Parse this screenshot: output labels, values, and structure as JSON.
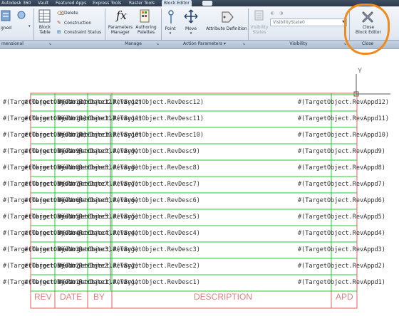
{
  "tabs": [
    "Autodesk 360",
    "Vault",
    "Featured Apps",
    "Express Tools",
    "Raster Tools",
    "Block Editor"
  ],
  "ribbon": {
    "left_partial": "gned",
    "block_table": [
      "Block",
      "Table"
    ],
    "delete": "Delete",
    "construction": "Construction",
    "constraint_status": "Constraint Status",
    "parameters_manager": [
      "Parameters",
      "Manager"
    ],
    "authoring_palettes": [
      "Authoring",
      "Palettes"
    ],
    "point": "Point",
    "move": "Move",
    "attribute_definition": "Attribute Definition",
    "visibility_states": [
      "Visibility",
      "States"
    ],
    "visibility_state_value": "VisibilityState0",
    "close_block_editor": [
      "Close",
      "Block Editor"
    ],
    "groups": {
      "dimensional": "mensional",
      "manage": "Manage",
      "action_parameters": "Action Parameters",
      "visibility": "Visibility",
      "close": "Close"
    },
    "highlight_color": "#f08a1c"
  },
  "drawing": {
    "ucs_y": "Y",
    "ucs_x": "X",
    "rows": [
      {
        "left": "#(TargetObject.RevNo12)",
        "mid": "#(TargetObject.RevDate12)",
        "by": "#(TargetObject.RevBy12)",
        "desc": "#(TargetObject.RevDesc12)",
        "apd": "#(TargetObject.RevAppd12)"
      },
      {
        "left": "#(TargetObject.RevNo11)",
        "mid": "#(TargetObject.RevDate11)",
        "by": "#(TargetObject.RevBy11)",
        "desc": "#(TargetObject.RevDesc11)",
        "apd": "#(TargetObject.RevAppd11)"
      },
      {
        "left": "#(TargetObject.RevNo10)",
        "mid": "#(TargetObject.RevDate10)",
        "by": "#(TargetObject.RevBy10)",
        "desc": "#(TargetObject.RevDesc10)",
        "apd": "#(TargetObject.RevAppd10)"
      },
      {
        "left": "#(TargetObject.RevNo9)",
        "mid": "#(TargetObject.RevDate9)",
        "by": "#(TargetObject.RevBy9)",
        "desc": "#(TargetObject.RevDesc9)",
        "apd": "#(TargetObject.RevAppd9)"
      },
      {
        "left": "#(TargetObject.RevNo8)",
        "mid": "#(TargetObject.RevDate8)",
        "by": "#(TargetObject.RevBy8)",
        "desc": "#(TargetObject.RevDesc8)",
        "apd": "#(TargetObject.RevAppd8)"
      },
      {
        "left": "#(TargetObject.RevNo7)",
        "mid": "#(TargetObject.RevDate7)",
        "by": "#(TargetObject.RevBy7)",
        "desc": "#(TargetObject.RevDesc7)",
        "apd": "#(TargetObject.RevAppd7)"
      },
      {
        "left": "#(TargetObject.RevNo6)",
        "mid": "#(TargetObject.RevDate6)",
        "by": "#(TargetObject.RevBy6)",
        "desc": "#(TargetObject.RevDesc6)",
        "apd": "#(TargetObject.RevAppd6)"
      },
      {
        "left": "#(TargetObject.RevNo5)",
        "mid": "#(TargetObject.RevDate5)",
        "by": "#(TargetObject.RevBy5)",
        "desc": "#(TargetObject.RevDesc5)",
        "apd": "#(TargetObject.RevAppd5)"
      },
      {
        "left": "#(TargetObject.RevNo4)",
        "mid": "#(TargetObject.RevDate4)",
        "by": "#(TargetObject.RevBy4)",
        "desc": "#(TargetObject.RevDesc4)",
        "apd": "#(TargetObject.RevAppd4)"
      },
      {
        "left": "#(TargetObject.RevNo3)",
        "mid": "#(TargetObject.RevDate3)",
        "by": "#(TargetObject.RevBy3)",
        "desc": "#(TargetObject.RevDesc3)",
        "apd": "#(TargetObject.RevAppd3)"
      },
      {
        "left": "#(TargetObject.RevNo2)",
        "mid": "#(TargetObject.RevDate2)",
        "by": "#(TargetObject.RevBy2)",
        "desc": "#(TargetObject.RevDesc2)",
        "apd": "#(TargetObject.RevAppd2)"
      },
      {
        "left": "#(TargetObject.RevNo1)",
        "mid": "#(TargetObject.RevDate1)",
        "by": "#(TargetObject.RevBy1)",
        "desc": "#(TargetObject.RevDesc1)",
        "apd": "#(TargetObject.RevAppd1)"
      }
    ],
    "headers": {
      "rev": "REV",
      "date": "DATE",
      "by": "BY",
      "description": "DESCRIPTION",
      "apd": "APD"
    },
    "colors": {
      "frame": "#e06060",
      "rows": "#22cc33",
      "header_text": "#e07f7f"
    }
  }
}
